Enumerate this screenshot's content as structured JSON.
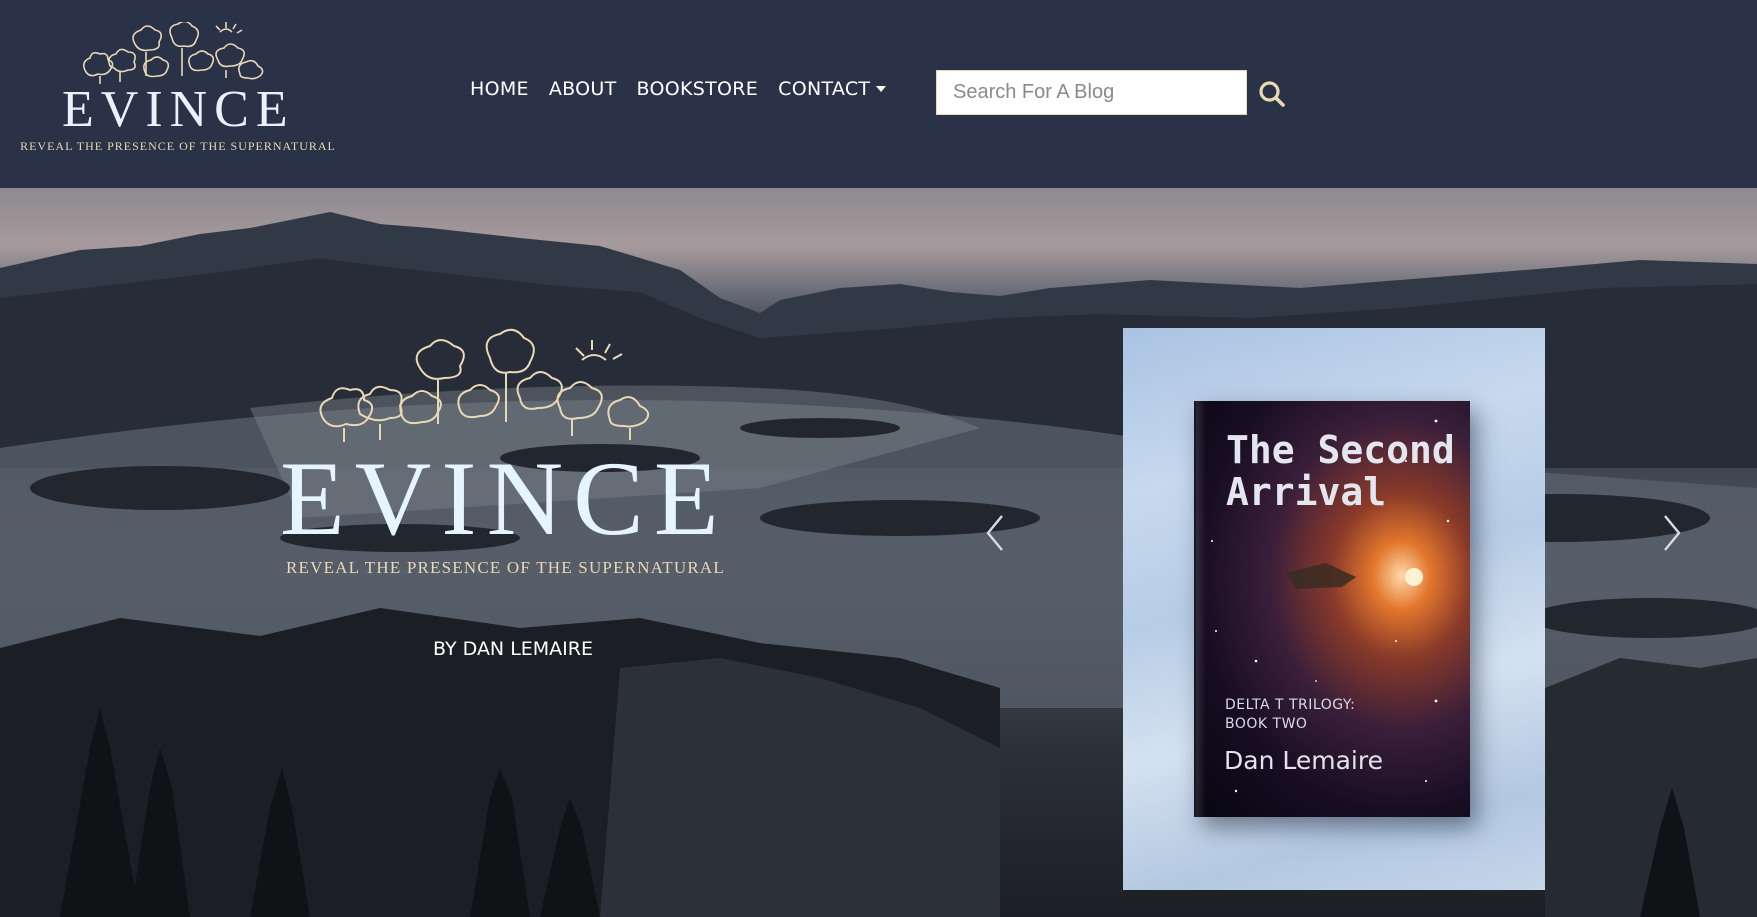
{
  "brand": {
    "name": "EVINCE",
    "tagline": "REVEAL THE PRESENCE OF THE SUPERNATURAL"
  },
  "nav": {
    "items": [
      {
        "label": "HOME"
      },
      {
        "label": "ABOUT"
      },
      {
        "label": "BOOKSTORE"
      },
      {
        "label": "CONTACT"
      }
    ]
  },
  "search": {
    "placeholder": "Search For A Blog",
    "value": ""
  },
  "hero": {
    "byline": "BY DAN LEMAIRE",
    "book": {
      "title": "The Second Arrival",
      "series_line1": "DELTA T TRILOGY:",
      "series_line2": "BOOK TWO",
      "author": "Dan Lemaire"
    }
  },
  "icons": {
    "search": "search-icon",
    "prev": "chevron-left-icon",
    "next": "chevron-right-icon",
    "dropdown": "caret-down-icon"
  },
  "colors": {
    "header_bg": "#2a3247",
    "accent_gold": "#e8d8b4",
    "wordmark": "#e9f3ff"
  }
}
